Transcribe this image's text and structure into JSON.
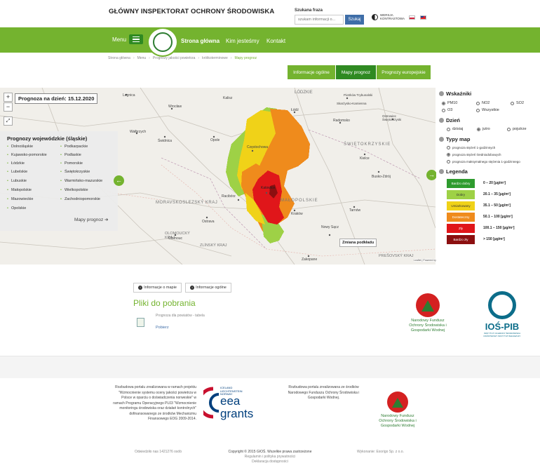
{
  "header": {
    "title": "GŁÓWNY INSPEKTORAT OCHRONY ŚRODOWISKA",
    "search_label": "Szukana fraza",
    "search_placeholder": "szukam informacji o...",
    "search_button": "Szukaj",
    "contrast_label": "WERSJA KONTRASTOWA"
  },
  "nav": {
    "menu_label": "Menu",
    "items": [
      "Strona główna",
      "Kim jesteśmy",
      "Kontakt"
    ]
  },
  "breadcrumb": [
    "Strona główna",
    "Menu",
    "Prognozy jakości powietrza",
    "krótkoterminowe",
    "Mapy prognoz"
  ],
  "tabs": [
    "Informacje ogólne",
    "Mapy prognoz",
    "Prognozy europejskie"
  ],
  "map": {
    "forecast_date": "Prognoza na dzień: 15.12.2020",
    "zoom_in": "+",
    "zoom_out": "−",
    "basemap_button": "Zmiana podkładu",
    "attribution": "Leaflet | Powered by Esri | Sources: Esri, Garmin, USGS, NPS, Sources: Esri, USGS, NOAA",
    "place_labels": [
      "Legnica",
      "Wrocław",
      "Kalisz",
      "Łódź",
      "Radomsko",
      "Opole",
      "Częstochowa",
      "Kielce",
      "Katowice",
      "Kraków",
      "Tarnów",
      "Racibórz",
      "Ostrava",
      "Nowy Sącz",
      "Zakopane",
      "Olomouc",
      "Wałbrzych",
      "Świdnica",
      "Busko-Zdrój",
      "Ostrowiec Świętokrzyski",
      "Skarżysko-Kamienna",
      "Piotrków Trybunalski"
    ],
    "region_labels": [
      "ŚWIĘTOKRZYSKIE",
      "MAŁOPOLSKIE",
      "MORAVSKOSLEZSKÝ KRAJ",
      "OLOMOUCKÝ KRAJ",
      "ZLÍNSKÝ KRAJ",
      "PREŠOVSKÝ KRAJ",
      "LÓDZKIE"
    ]
  },
  "voivodeships": {
    "title": "Prognozy wojewódzkie (śląskie)",
    "col1": [
      "Dolnośląskie",
      "Kujawsko-pomorskie",
      "Łódzkie",
      "Lubelskie",
      "Lubuskie",
      "Małopolskie",
      "Mazowieckie",
      "Opolskie"
    ],
    "col2": [
      "Podkarpackie",
      "Podlaskie",
      "Pomorskie",
      "Świętokrzyskie",
      "Warmińsko-mazurskie",
      "Wielkopolskie",
      "Zachodniopomorskie"
    ],
    "more_link": "Mapy prognoz"
  },
  "panel": {
    "indicators_title": "Wskaźniki",
    "indicators": [
      {
        "label": "PM10",
        "selected": true
      },
      {
        "label": "NO2",
        "selected": false
      },
      {
        "label": "SO2",
        "selected": false
      },
      {
        "label": "O3",
        "selected": false
      },
      {
        "label": "Wszystkie",
        "selected": false
      }
    ],
    "day_title": "Dzień",
    "days": [
      {
        "label": "dzisiaj",
        "selected": false
      },
      {
        "label": "jutro",
        "selected": true
      },
      {
        "label": "pojutrze",
        "selected": false
      }
    ],
    "maptypes_title": "Typy map",
    "maptypes": [
      {
        "label": "prognoza stężeń 1-godzinnych",
        "selected": false
      },
      {
        "label": "prognoza stężeń średniodobowych",
        "selected": true
      },
      {
        "label": "prognoza maksymalnego stężenia 1-godzinnego",
        "selected": false
      }
    ],
    "legend_title": "Legenda",
    "legend": [
      {
        "label": "Bardzo dobry",
        "range": "0 – 20 [µg/m³]",
        "color": "#2e9b2e"
      },
      {
        "label": "Dobry",
        "range": "20.1 – 35 [µg/m³]",
        "color": "#9ed146"
      },
      {
        "label": "Umiarkowany",
        "range": "35.1 – 50 [µg/m³]",
        "color": "#f0d218"
      },
      {
        "label": "Dostateczny",
        "range": "50.1 – 100 [µg/m³]",
        "color": "#ef8b1c"
      },
      {
        "label": "Zły",
        "range": "100.1 – 150 [µg/m³]",
        "color": "#e0161a"
      },
      {
        "label": "Bardzo zły",
        "range": "> 150 [µg/m³]",
        "color": "#8c0f10"
      }
    ]
  },
  "lower": {
    "info_map_btn": "Informacje o mapie",
    "info_general_btn": "Informacje ogólne",
    "downloads_title": "Pliki do pobrania",
    "file_name": "Prognoza dla powiatów - tabela",
    "file_download": "Pobierz",
    "nfos_text": "Narodowy Fundusz Ochrony Środowiska i Gospodarki Wodnej",
    "ios_text": "IOŚ-PIB",
    "ios_sub": "INSTYTUT OCHRONY ŚRODOWISKA PAŃSTWOWY INSTYTUT BADAWCZY"
  },
  "footer": {
    "left_text": "Rozbudowa portalu zrealizowana w ramach projektu \"Wzmocnienie systemu oceny jakości powietrza w Polsce w oparciu o doświadczenia norweskie\" w ramach Programu Operacyjnego PL03 \"Wzmocnienie monitoringu środowiska oraz działań kontrolnych\" dofinansowanego ze środków Mechanizmu Finansowego EOG 2009-2014.",
    "eea_small": "ICELAND LIECHTENSTEIN NORWAY",
    "eea_big1": "eea",
    "eea_big2": "grants",
    "mid_text": "Rozbudowa portalu zrealizowana ze środków Narodowego Funduszu Ochrony Środowiska i Gospodarki Wodnej.",
    "nfos_text": "Narodowy Fundusz Ochrony Środowiska i Gospodarki Wodnej",
    "visits": "Odwiedziło nas 1421276 osób",
    "copyright": "Copyright © 2015 GIOŚ. Wszelkie prawa zastrzeżone",
    "privacy": "Regulamin i polityka prywatności",
    "accessibility": "Deklaracja dostępności",
    "author": "Wykonanie: Exorigo Sp. z o.o."
  }
}
